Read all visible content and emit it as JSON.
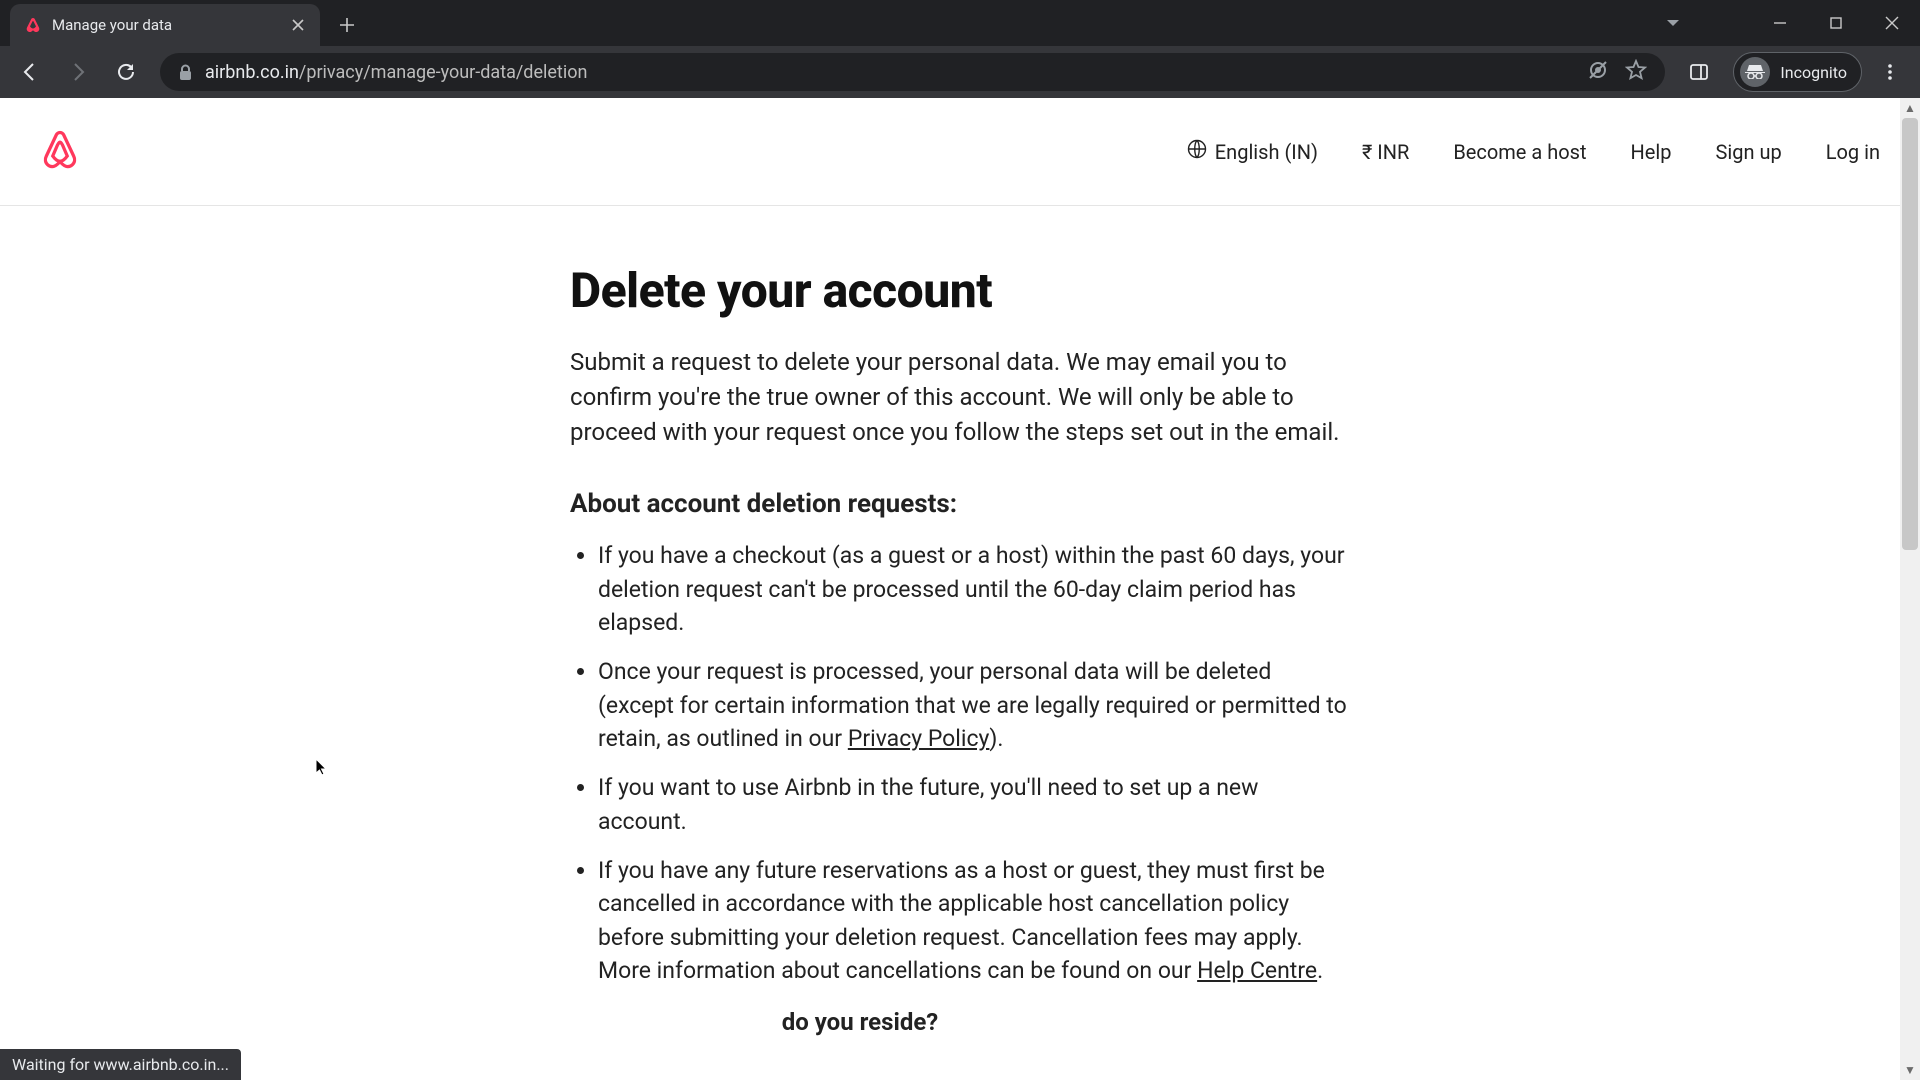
{
  "browser": {
    "tab_title": "Manage your data",
    "url_host": "airbnb.co.in",
    "url_path": "/privacy/manage-your-data/deletion",
    "incognito_label": "Incognito",
    "status_text": "Waiting for www.airbnb.co.in..."
  },
  "header": {
    "language": "English (IN)",
    "currency": "₹ INR",
    "nav": {
      "become_host": "Become a host",
      "help": "Help",
      "sign_up": "Sign up",
      "log_in": "Log in"
    }
  },
  "main": {
    "title": "Delete your account",
    "intro": "Submit a request to delete your personal data. We may email you to confirm you're the true owner of this account. We will only be able to proceed with your request once you follow the steps set out in the email.",
    "subheading": "About account deletion requests:",
    "bullets": {
      "b0": "If you have a checkout (as a guest or a host) within the past 60 days, your deletion request can't be processed until the 60-day claim period has elapsed.",
      "b1_a": "Once your request is processed, your personal data will be deleted (except for certain information that we are legally required or permitted to retain, as outlined in our ",
      "b1_link": "Privacy Policy",
      "b1_b": ").",
      "b2": "If you want to use Airbnb in the future, you'll need to set up a new account.",
      "b3_a": "If you have any future reservations as a host or guest, they must first be cancelled in accordance with the applicable host cancellation policy before submitting your deletion request. Cancellation fees may apply. More information about cancellations can be found on our ",
      "b3_link": "Help Centre",
      "b3_b": "."
    },
    "reside_partial": "do you reside?"
  },
  "colors": {
    "brand": "#ff385c"
  }
}
